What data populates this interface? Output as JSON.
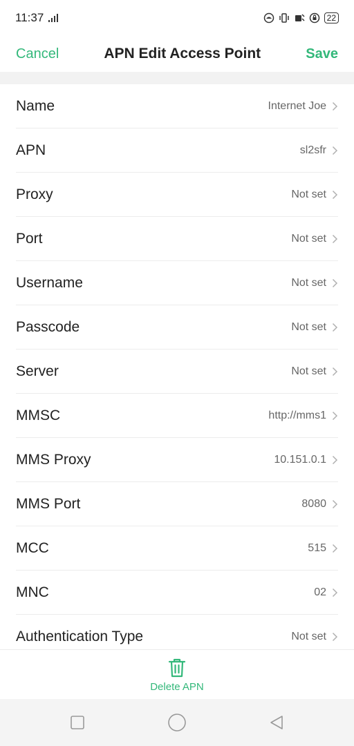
{
  "status_bar": {
    "time": "11:37",
    "battery": "22",
    "icons": [
      "signal-icon",
      "sim-icon",
      "vibrate-icon",
      "data-icon",
      "lock-icon"
    ]
  },
  "header": {
    "cancel_label": "Cancel",
    "title": "APN Edit Access Point",
    "save_label": "Save"
  },
  "fields": [
    {
      "label": "Name",
      "value": "Internet Joe"
    },
    {
      "label": "APN",
      "value": "sl2sfr"
    },
    {
      "label": "Proxy",
      "value": "Not set"
    },
    {
      "label": "Port",
      "value": "Not set"
    },
    {
      "label": "Username",
      "value": "Not set"
    },
    {
      "label": "Passcode",
      "value": "Not set"
    },
    {
      "label": "Server",
      "value": "Not set"
    },
    {
      "label": "MMSC",
      "value": "http://mms1"
    },
    {
      "label": "MMS Proxy",
      "value": "10.151.0.1"
    },
    {
      "label": "MMS Port",
      "value": "8080"
    },
    {
      "label": "MCC",
      "value": "515"
    },
    {
      "label": "MNC",
      "value": "02"
    },
    {
      "label": "Authentication Type",
      "value": "Not set"
    }
  ],
  "bottom": {
    "delete_label": "Delete APN",
    "icon": "trash-icon"
  },
  "nav": {
    "icons": [
      "recents-square-icon",
      "home-circle-icon",
      "back-triangle-icon"
    ]
  },
  "colors": {
    "accent": "#33b87a",
    "text": "#222222",
    "secondary_text": "#666666"
  }
}
